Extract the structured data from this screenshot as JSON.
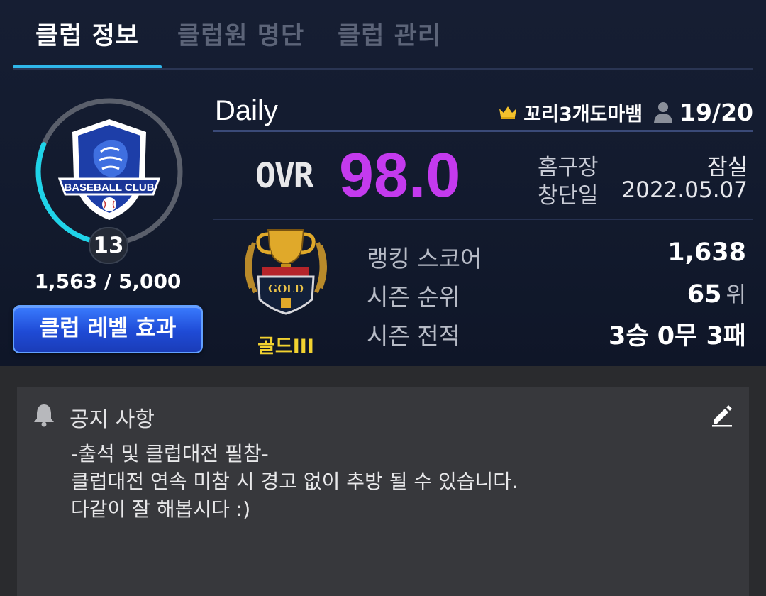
{
  "tabs": [
    {
      "label": "클럽 정보",
      "active": true
    },
    {
      "label": "클럽원 명단",
      "active": false
    },
    {
      "label": "클럽 관리",
      "active": false
    }
  ],
  "club": {
    "name": "Daily",
    "emblem_text": "BASEBALL CLUB",
    "level": "13",
    "exp": "1,563 / 5,000",
    "exp_fraction": 0.3126,
    "level_effect_label": "클럽 레벨 효과",
    "master_name": "꼬리3개도마뱀",
    "members": "19/20"
  },
  "ovr": {
    "label": "OVR",
    "value": "98.0"
  },
  "info": {
    "home_label": "홈구장",
    "home_value": "잠실",
    "founded_label": "창단일",
    "founded_value": "2022.05.07"
  },
  "grade": {
    "name": "골드III",
    "emblem_text": "GOLD"
  },
  "stats": {
    "score_label": "랭킹 스코어",
    "score_value": "1,638",
    "rank_label": "시즌 순위",
    "rank_value": "65",
    "rank_unit": "위",
    "record_label": "시즌 전적",
    "record_value": "3승 0무 3패"
  },
  "notice": {
    "title": "공지 사항",
    "lines": [
      "-출석 및 클럽대전 필참-",
      "클럽대전 연속 미참 시 경고 없이 추방 될 수 있습니다.",
      "다같이 잘 해봅시다 :)"
    ]
  },
  "colors": {
    "accent_tab": "#2fb7ea",
    "ovr": "#c43aee",
    "ring_progress": "#1fd3e8",
    "grade_text": "#f2d230",
    "button": "#1f4bd6"
  },
  "icons": [
    "crown-icon",
    "person-icon",
    "bell-icon",
    "edit-icon"
  ]
}
